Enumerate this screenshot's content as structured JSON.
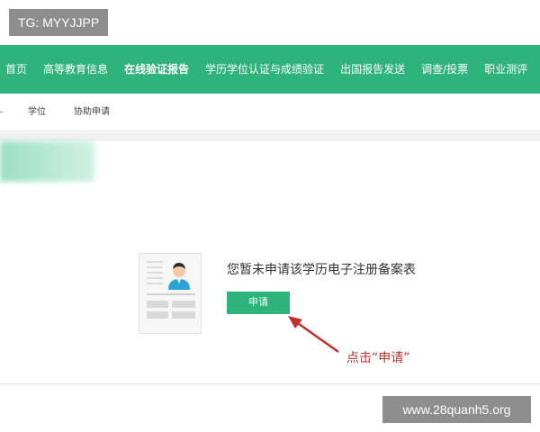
{
  "watermark_top": "TG: MYYJJPP",
  "watermark_bottom": "www.28quanh5.org",
  "nav": {
    "items": [
      {
        "label": "首页"
      },
      {
        "label": "高等教育信息"
      },
      {
        "label": "在线验证报告"
      },
      {
        "label": "学历学位认证与成绩验证"
      },
      {
        "label": "出国报告发送"
      },
      {
        "label": "调查/投票"
      },
      {
        "label": "职业测评"
      }
    ],
    "active_index": 2
  },
  "subnav": {
    "items": [
      {
        "label": "学位"
      },
      {
        "label": "协助申请"
      }
    ]
  },
  "content": {
    "empty_text": "您暂未申请该学历电子注册备案表",
    "apply_label": "申请"
  },
  "annotation": "点击“申请”",
  "colors": {
    "brand_green": "#2fb37c",
    "annotation_red": "#c0302b",
    "watermark_gray": "#8e8e8e"
  },
  "icons": {
    "document_illustration": "document-avatar-icon",
    "arrow": "red-arrow-icon"
  }
}
